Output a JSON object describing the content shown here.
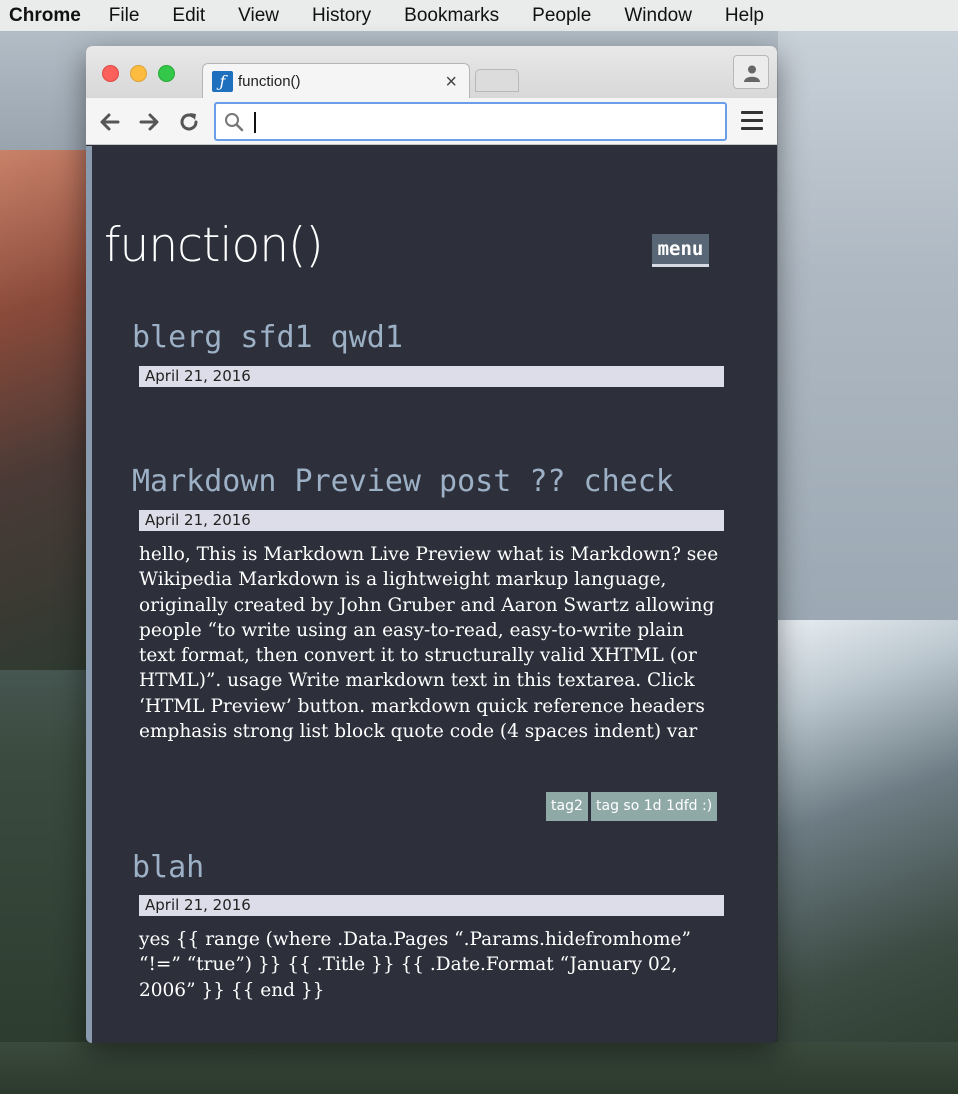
{
  "menubar": {
    "app": "Chrome",
    "items": [
      "File",
      "Edit",
      "View",
      "History",
      "Bookmarks",
      "People",
      "Window",
      "Help"
    ]
  },
  "browser": {
    "tab_title": "function()",
    "tab_close": "×",
    "favicon_glyph": "ƒ",
    "omnibox_value": "",
    "omnibox_placeholder": ""
  },
  "site": {
    "title": "function()",
    "menu_label": "menu"
  },
  "posts": [
    {
      "title": "blerg sfd1 qwd1",
      "date": "April 21, 2016",
      "body": "",
      "tags": []
    },
    {
      "title": "Markdown Preview post ?? check",
      "date": "April 21, 2016",
      "body": "hello, This is Markdown Live Preview what is Markdown? see Wikipedia Markdown is a lightweight markup language, originally created by John Gruber and Aaron Swartz allowing people “to write using an easy-to-read, easy-to-write plain text format, then convert it to structurally valid XHTML (or HTML)”. usage Write markdown text in this textarea. Click ‘HTML Preview’ button. markdown quick reference headers emphasis strong list block quote code (4 spaces indent) var",
      "tags": [
        "tag2",
        "tag so 1d 1dfd :)"
      ]
    },
    {
      "title": "blah",
      "date": "April 21, 2016",
      "body": "yes {{ range (where .Data.Pages “.Params.hidefromhome” “!=” “true”) }} {{ .Title }} {{ .Date.Format “January 02, 2006” }} {{ end }}",
      "tags": []
    }
  ],
  "colors": {
    "page_bg": "#2d2f3a",
    "post_title": "#9cb0c6",
    "date_bar": "#dcdde8",
    "tag_bg": "#8fa9a6",
    "menu_bg": "#586676"
  }
}
